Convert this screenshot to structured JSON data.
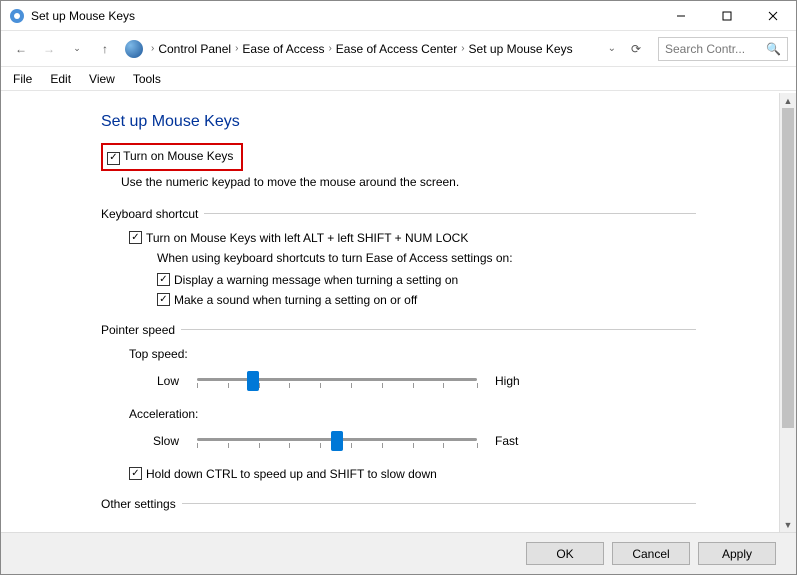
{
  "window": {
    "title": "Set up Mouse Keys"
  },
  "breadcrumb": [
    "Control Panel",
    "Ease of Access",
    "Ease of Access Center",
    "Set up Mouse Keys"
  ],
  "search": {
    "placeholder": "Search Contr..."
  },
  "menu": [
    "File",
    "Edit",
    "View",
    "Tools"
  ],
  "page": {
    "heading": "Set up Mouse Keys",
    "turn_on": "Turn on Mouse Keys",
    "turn_on_desc": "Use the numeric keypad to move the mouse around the screen.",
    "kb_section": "Keyboard shortcut",
    "kb_check": "Turn on Mouse Keys with left ALT + left SHIFT + NUM LOCK",
    "kb_note": "When using keyboard shortcuts to turn Ease of Access settings on:",
    "kb_warn": "Display a warning message when turning a setting on",
    "kb_sound": "Make a sound when turning a setting on or off",
    "ps_section": "Pointer speed",
    "top_speed_label": "Top speed:",
    "low": "Low",
    "high": "High",
    "accel_label": "Acceleration:",
    "slow": "Slow",
    "fast": "Fast",
    "ctrl_shift": "Hold down CTRL to speed up and SHIFT to slow down",
    "other_section": "Other settings"
  },
  "sliders": {
    "top_speed_pct": 20,
    "accel_pct": 50
  },
  "buttons": {
    "ok": "OK",
    "cancel": "Cancel",
    "apply": "Apply"
  }
}
